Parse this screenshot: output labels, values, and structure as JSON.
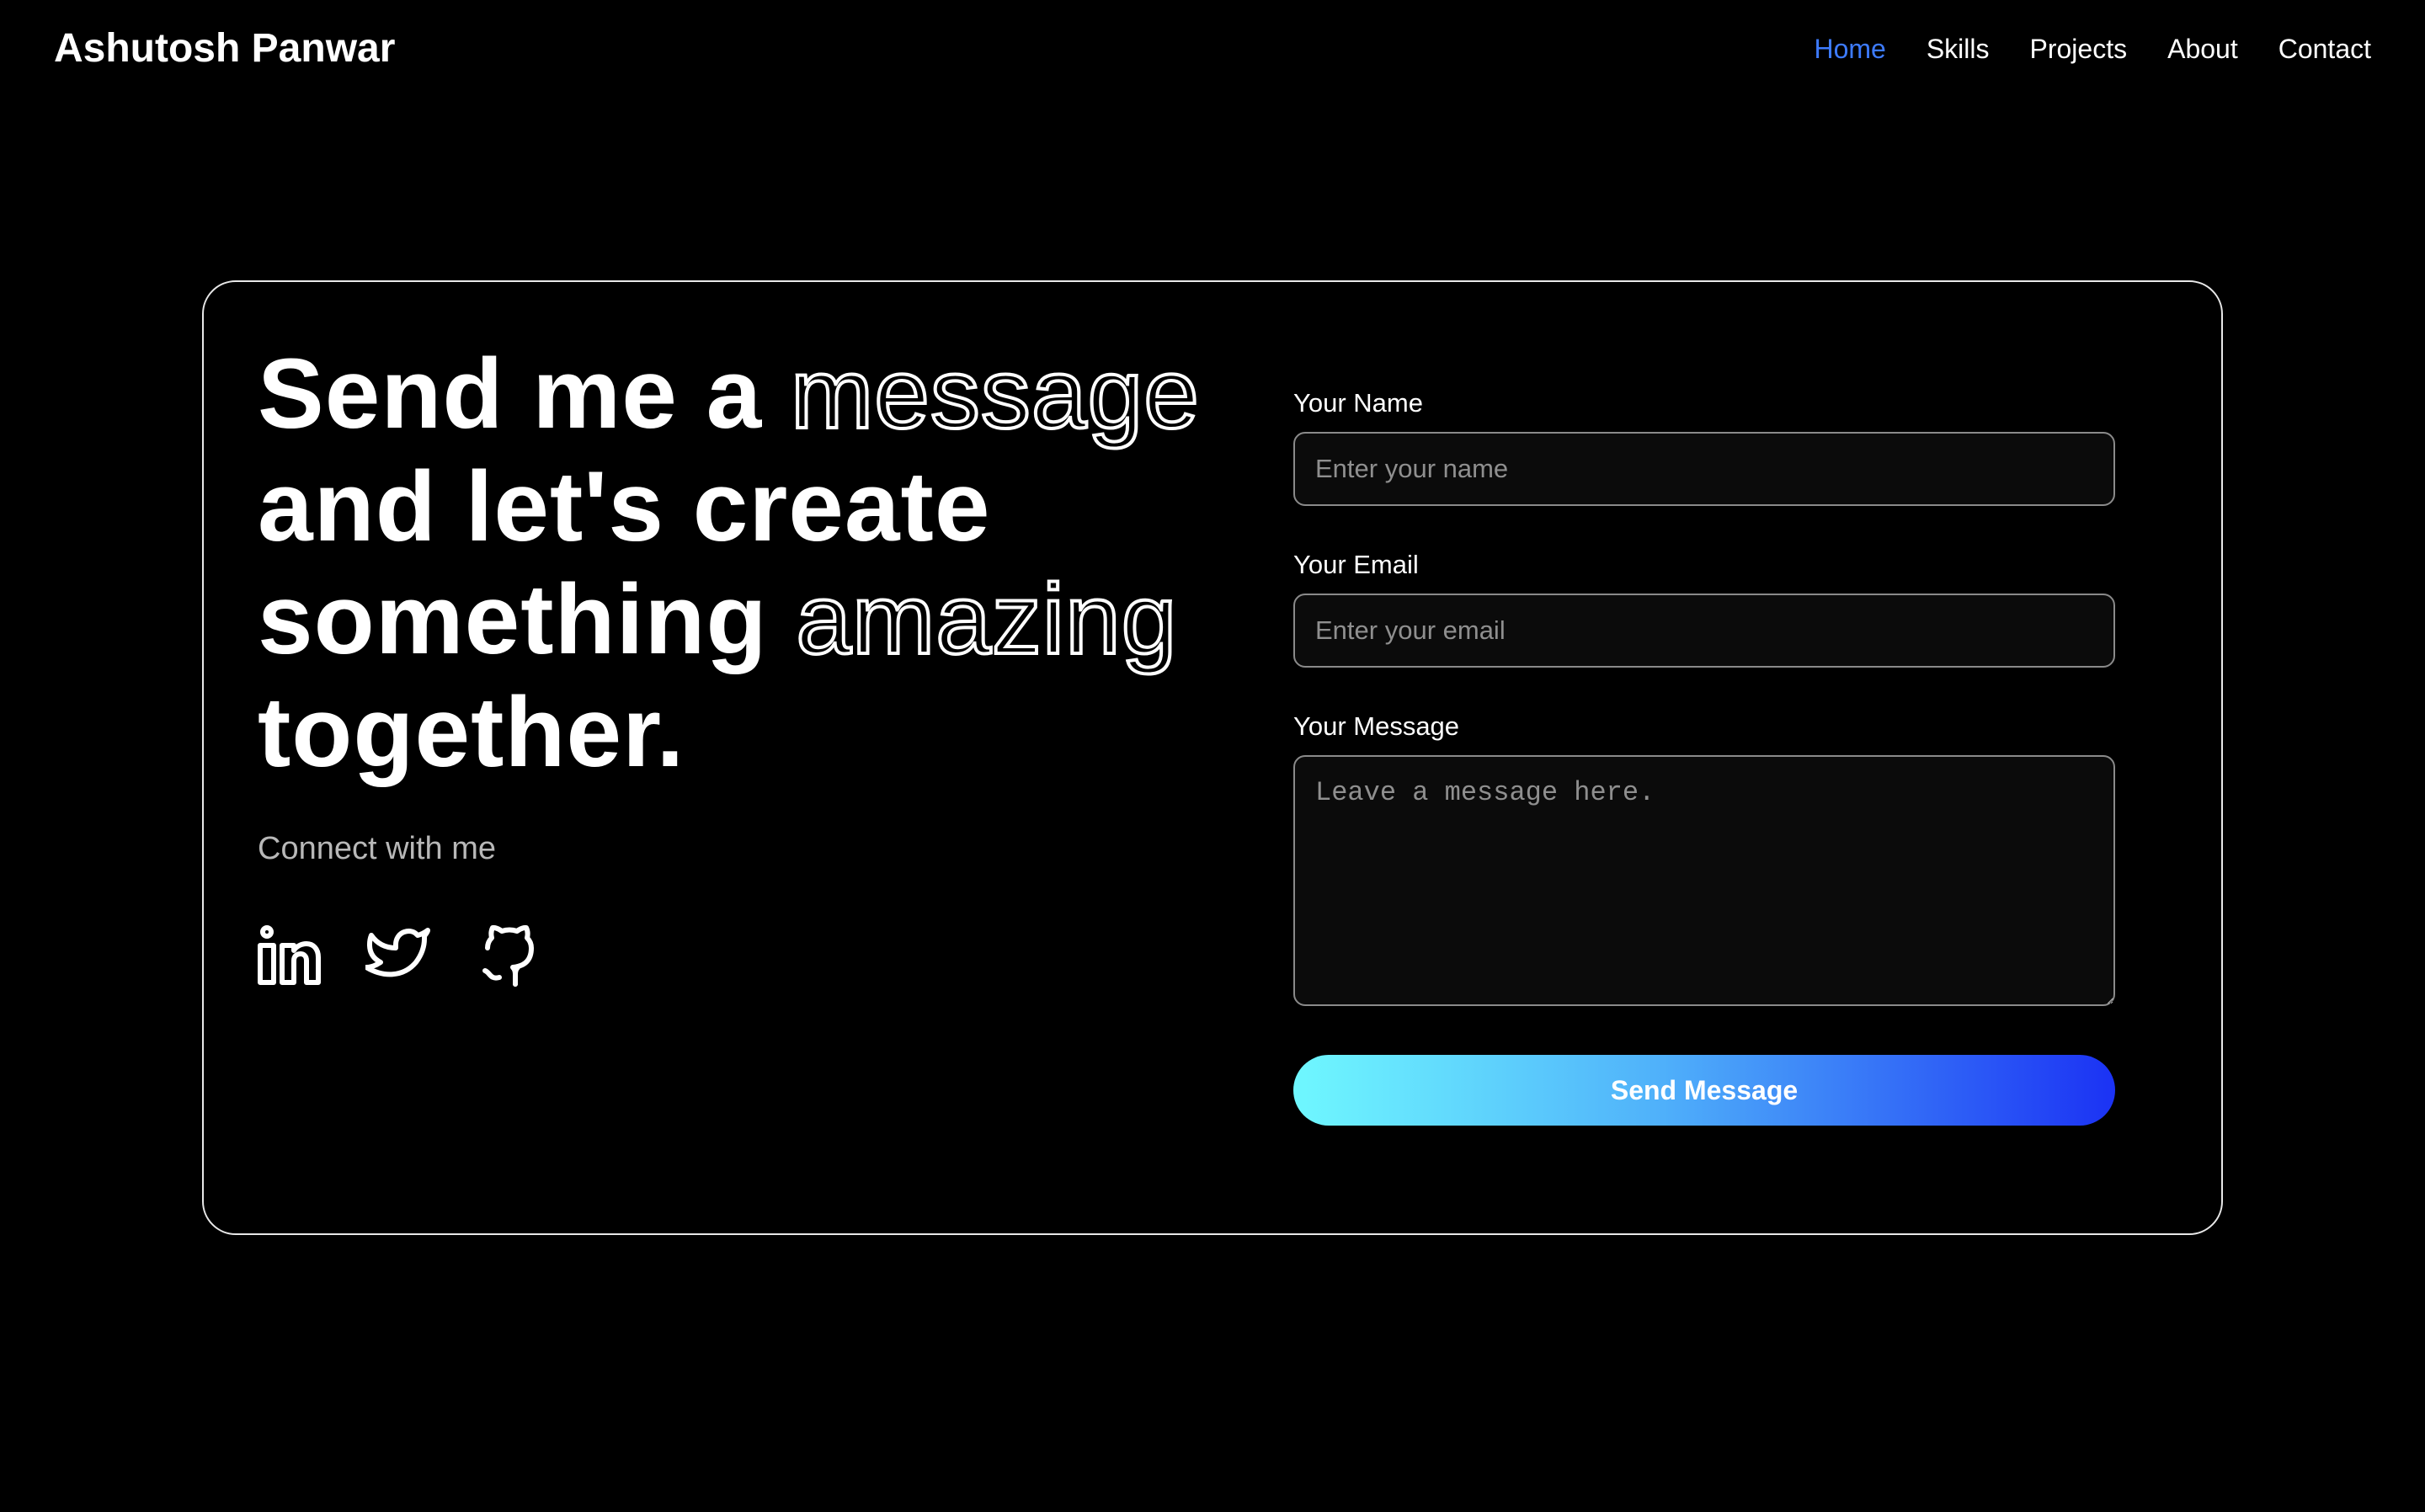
{
  "nav": {
    "brand": "Ashutosh Panwar",
    "links": [
      "Home",
      "Skills",
      "Projects",
      "About",
      "Contact"
    ],
    "active_link": "Home",
    "active_color": "#3d7bff"
  },
  "hero": {
    "line1_solid": "Send me a ",
    "line1_outline": "message",
    "line2_solid": "and let's create",
    "line3_solid": "something ",
    "line3_outline": "amazing",
    "line4_solid": "together.",
    "connect_text": "Connect with me",
    "socials": [
      "linkedin-icon",
      "twitter-icon",
      "github-icon"
    ]
  },
  "form": {
    "name_label": "Your Name",
    "name_placeholder": "Enter your name",
    "name_value": "",
    "email_label": "Your Email",
    "email_placeholder": "Enter your email",
    "email_value": "",
    "message_label": "Your Message",
    "message_placeholder": "Leave a message here.",
    "message_value": "",
    "submit_label": "Send Message",
    "submit_gradient": [
      "#6ff8ff",
      "#4fb0fa",
      "#1b32f4"
    ]
  }
}
